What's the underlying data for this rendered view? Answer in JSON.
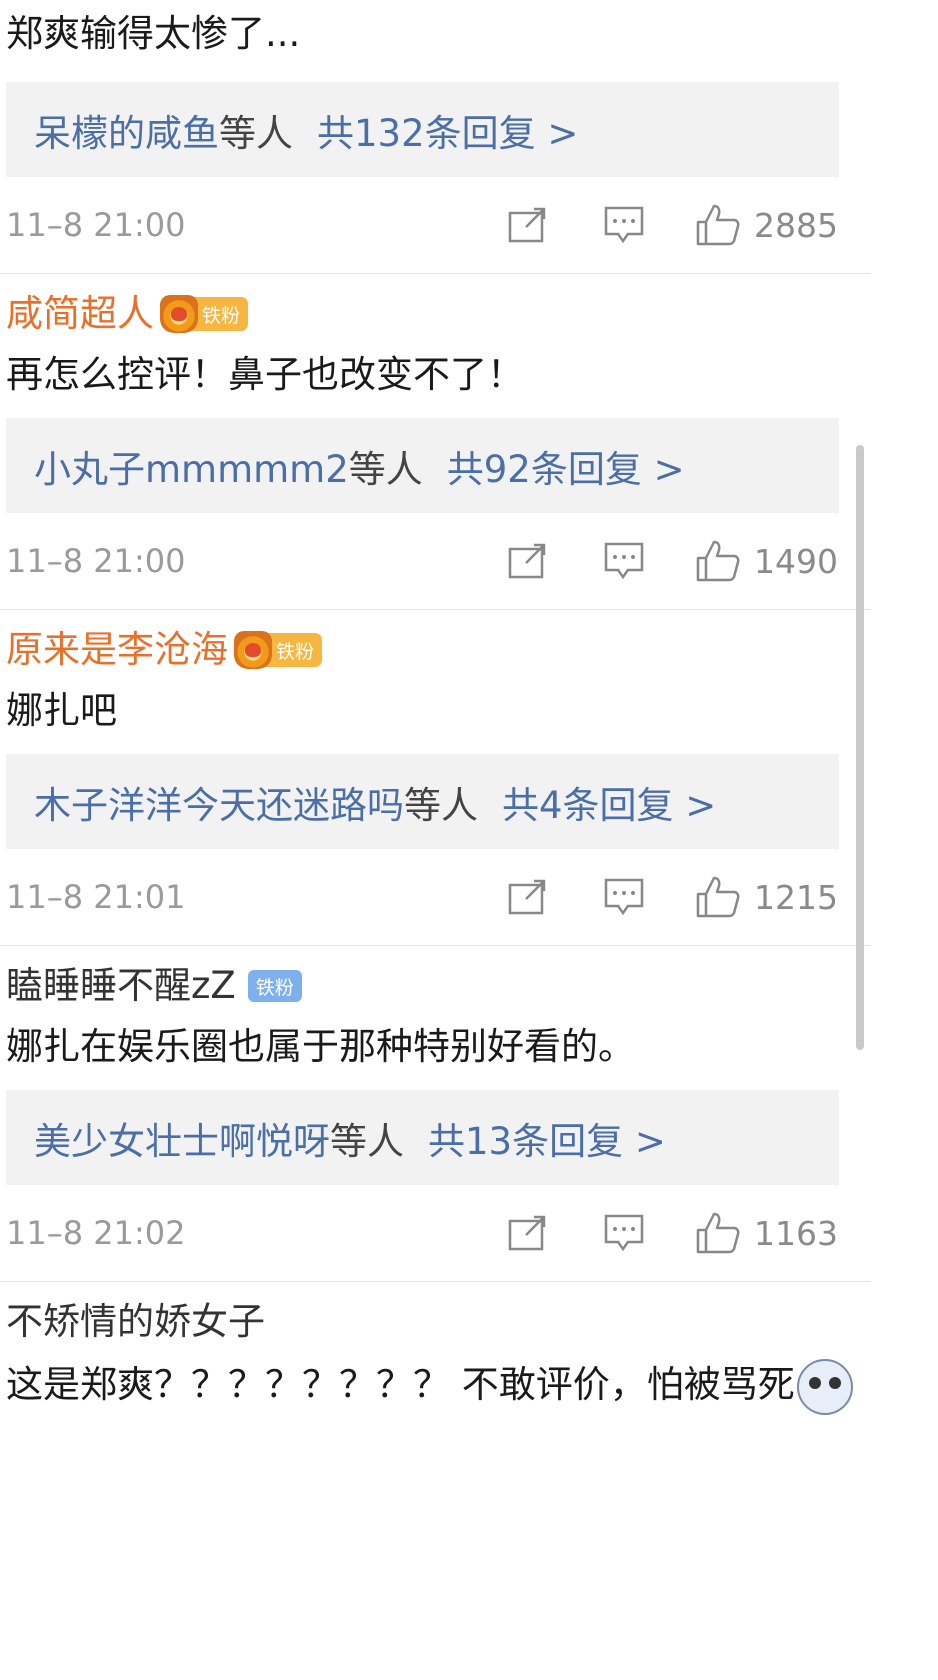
{
  "comments": [
    {
      "username": "",
      "text": "郑爽输得太惨了...",
      "replies": {
        "names": "呆檬的咸鱼",
        "suffix": "等人",
        "count": "共132条回复 >"
      },
      "time": "11–8 21:00",
      "likes": "2885"
    },
    {
      "username": "咸简超人",
      "badge": "铁粉",
      "text": "再怎么控评！鼻子也改变不了！",
      "replies": {
        "names": "小丸子mmmmm2",
        "suffix": "等人",
        "count": "共92条回复 >"
      },
      "time": "11–8 21:00",
      "likes": "1490"
    },
    {
      "username": "原来是李沧海",
      "badge": "铁粉",
      "text": "娜扎吧",
      "replies": {
        "names": "木子洋洋今天还迷路吗",
        "suffix": "等人",
        "count": "共4条回复 >"
      },
      "time": "11–8 21:01",
      "likes": "1215"
    },
    {
      "username": "瞌睡睡不醒zZ",
      "badge": "铁粉",
      "text": "娜扎在娱乐圈也属于那种特别好看的。",
      "replies": {
        "names": "美少女壮士啊悦呀",
        "suffix": "等人",
        "count": "共13条回复 >"
      },
      "time": "11–8 21:02",
      "likes": "1163"
    },
    {
      "username": "不矫情的娇女子",
      "text": "这是郑爽？？？？？？？？ 不敢评价，怕被骂死"
    }
  ],
  "icons": {
    "share": "share-icon",
    "comment": "comment-icon",
    "like": "thumbs-up-icon",
    "emoji": "dog-face-emoji-icon"
  },
  "colors": {
    "username_highlight": "#e8702a",
    "reply_link": "#4a6ea8",
    "crown_badge": "#f6b640",
    "fan_badge_blue": "#7fb0ee"
  }
}
